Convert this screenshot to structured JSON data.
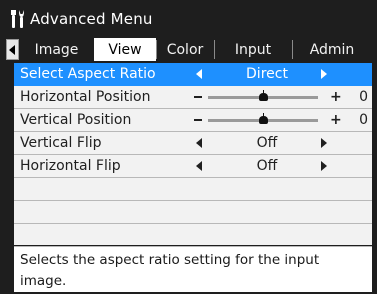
{
  "title": "Advanced Menu",
  "tabs": [
    {
      "label": "Image",
      "active": false
    },
    {
      "label": "View",
      "active": true
    },
    {
      "label": "Color",
      "active": false
    },
    {
      "label": "Input",
      "active": false
    },
    {
      "label": "Admin",
      "active": false
    }
  ],
  "rows": {
    "aspect": {
      "label": "Select Aspect Ratio",
      "value": "Direct"
    },
    "hpos": {
      "label": "Horizontal Position",
      "value": "0",
      "level": 0.5
    },
    "vpos": {
      "label": "Vertical Position",
      "value": "0",
      "level": 0.5
    },
    "vflip": {
      "label": "Vertical Flip",
      "value": "Off"
    },
    "hflip": {
      "label": "Horizontal Flip",
      "value": "Off"
    }
  },
  "slider": {
    "minus": "−",
    "plus": "+"
  },
  "help_text": "Selects the aspect ratio setting for the input image.",
  "icons": {
    "title": "tools-icon",
    "tab_prev": "left-arrow-icon"
  },
  "colors": {
    "background": "#1e1e1e",
    "selection": "#1e90ff",
    "menu": "#f2f2f2",
    "active_tab": "#ffffff"
  }
}
